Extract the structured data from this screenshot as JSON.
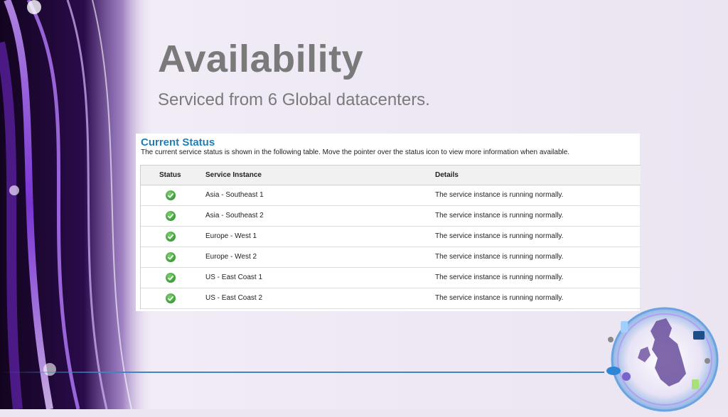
{
  "slide": {
    "title": "Availability",
    "subtitle": "Serviced from 6 Global datacenters."
  },
  "status_panel": {
    "title": "Current Status",
    "description": "The current service status is shown in the following table. Move the pointer over the status icon to view more information when available.",
    "columns": [
      "Status",
      "Service Instance",
      "Details"
    ],
    "rows": [
      {
        "status_icon": "check-circle-icon",
        "instance": "Asia - Southeast 1",
        "details": "The service instance is running normally."
      },
      {
        "status_icon": "check-circle-icon",
        "instance": "Asia - Southeast 2",
        "details": "The service instance is running normally."
      },
      {
        "status_icon": "check-circle-icon",
        "instance": "Europe - West 1",
        "details": "The service instance is running normally."
      },
      {
        "status_icon": "check-circle-icon",
        "instance": "Europe - West 2",
        "details": "The service instance is running normally."
      },
      {
        "status_icon": "check-circle-icon",
        "instance": "US - East Coast 1",
        "details": "The service instance is running normally."
      },
      {
        "status_icon": "check-circle-icon",
        "instance": "US - East Coast 2",
        "details": "The service instance is running normally."
      }
    ]
  },
  "colors": {
    "title_gray": "#7a7a7a",
    "panel_title_blue": "#1f7fb5",
    "status_ok_green": "#3c9a3a",
    "divider_blue": "#3f86c6",
    "accent_purple": "#7a2cd6"
  },
  "decoration": {
    "left_graphic": "purple-light-streaks",
    "corner_graphic": "uk-map-globe-icon"
  }
}
